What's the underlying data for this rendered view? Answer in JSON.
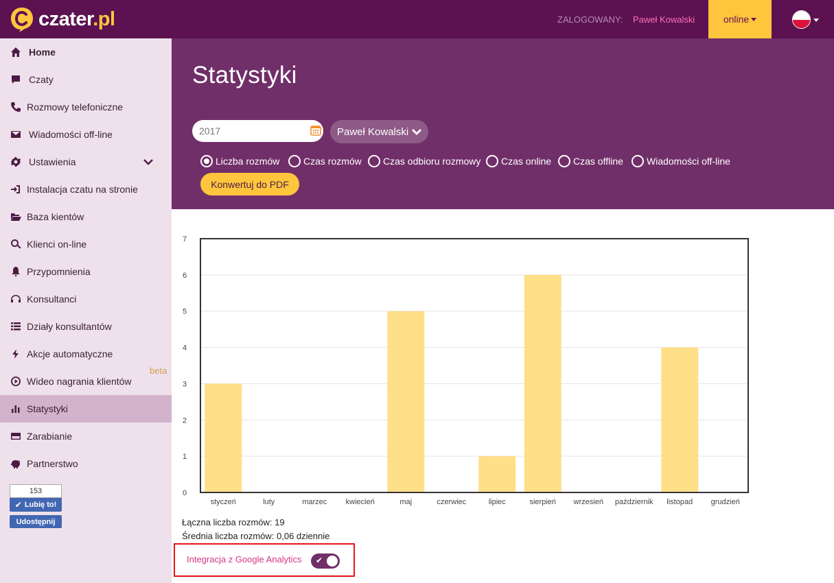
{
  "topbar": {
    "logo_text": "czater",
    "logo_suffix": ".pl",
    "logged_label": "ZALOGOWANY:",
    "user_name": "Paweł Kowalski",
    "status_label": "online"
  },
  "sidebar": {
    "items": [
      {
        "label": "Home",
        "icon": "home-icon"
      },
      {
        "label": "Czaty",
        "icon": "chat-icon"
      },
      {
        "label": "Rozmowy telefoniczne",
        "icon": "phone-icon"
      },
      {
        "label": "Wiadomości off-line",
        "icon": "envelope-icon"
      },
      {
        "label": "Ustawienia",
        "icon": "gear-icon"
      },
      {
        "label": "Instalacja czatu na stronie",
        "icon": "sign-in-icon"
      },
      {
        "label": "Baza kientów",
        "icon": "folder-icon"
      },
      {
        "label": "Klienci on-line",
        "icon": "search-icon"
      },
      {
        "label": "Przypomnienia",
        "icon": "bell-icon"
      },
      {
        "label": "Konsultanci",
        "icon": "headphones-icon"
      },
      {
        "label": "Działy konsultantów",
        "icon": "list-icon"
      },
      {
        "label": "Akcje automatyczne",
        "icon": "bolt-icon"
      },
      {
        "label": "Wideo nagrania klientów",
        "icon": "play-circle-icon",
        "badge": "beta"
      },
      {
        "label": "Statystyki",
        "icon": "bar-chart-icon"
      },
      {
        "label": "Zarabianie",
        "icon": "credit-card-icon"
      },
      {
        "label": "Partnerstwo",
        "icon": "piggy-bank-icon"
      }
    ],
    "facebook": {
      "count": "153",
      "like_label": "Lubię to!",
      "share_label": "Udostępnij"
    }
  },
  "header": {
    "title": "Statystyki",
    "year_placeholder": "2017",
    "user_select": "Paweł Kowalski",
    "radios": [
      {
        "label": "Liczba rozmów",
        "checked": true
      },
      {
        "label": "Czas rozmów",
        "checked": false
      },
      {
        "label": "Czas odbioru rozmowy",
        "checked": false
      },
      {
        "label": "Czas online",
        "checked": false
      },
      {
        "label": "Czas offline",
        "checked": false
      },
      {
        "label": "Wiadomości off-line",
        "checked": false
      }
    ],
    "pdf_button": "Konwertuj do PDF"
  },
  "chart_data": {
    "type": "bar",
    "categories": [
      "styczeń",
      "luty",
      "marzec",
      "kwiecień",
      "maj",
      "czerwiec",
      "lipiec",
      "sierpień",
      "wrzesień",
      "październik",
      "listopad",
      "grudzień"
    ],
    "values": [
      3,
      0,
      0,
      0,
      5,
      0,
      1,
      6,
      0,
      0,
      4,
      0
    ],
    "ylim": [
      0,
      7
    ],
    "yticks": [
      0,
      1,
      2,
      3,
      4,
      5,
      6,
      7
    ],
    "bar_color": "#ffdf87",
    "grid": true
  },
  "stats": {
    "total": "Łączna liczba rozmów: 19",
    "average": "Średnia liczba rozmów: 0,06 dziennie"
  },
  "integration": {
    "label": "Integracja z Google Analytics",
    "enabled": true
  },
  "colors": {
    "primary": "#5c1250",
    "header": "#712f69",
    "accent": "#ffc53d",
    "highlight": "#e2141b"
  }
}
